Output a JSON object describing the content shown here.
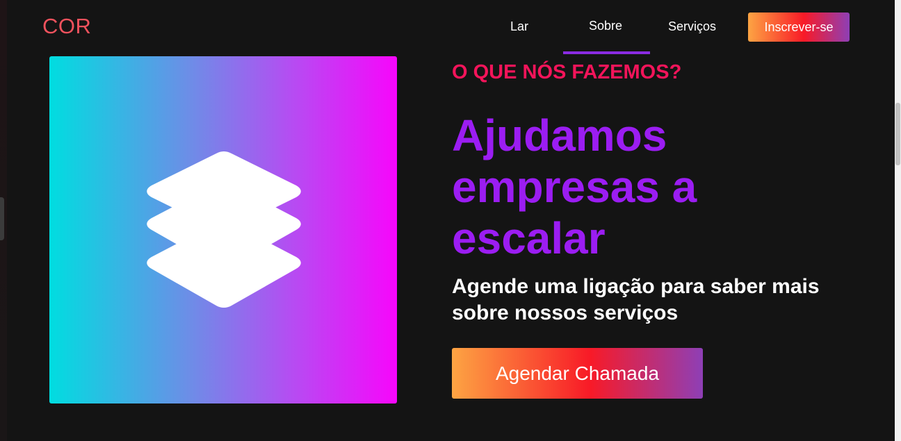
{
  "header": {
    "logo": "COR",
    "nav": [
      {
        "label": "Lar",
        "active": false
      },
      {
        "label": "Sobre",
        "active": true
      },
      {
        "label": "Serviços",
        "active": false
      }
    ],
    "signup_label": "Inscrever-se"
  },
  "hero": {
    "icon": "layers-icon",
    "eyebrow": "O QUE NÓS FAZEMOS?",
    "headline": "Ajudamos empresas a escalar",
    "subhead": "Agende uma ligação para saber mais sobre nossos serviços",
    "cta_label": "Agendar Chamada"
  },
  "colors": {
    "background": "#141414",
    "logo": "#f0525d",
    "eyebrow": "#f3145a",
    "headline": "#9b1df2",
    "nav_underline": "#8a2be2",
    "button_gradient": [
      "#fda443",
      "#f81a27",
      "#8e3fb6"
    ],
    "hero_gradient": [
      "#00dde0",
      "#f706fb"
    ]
  }
}
